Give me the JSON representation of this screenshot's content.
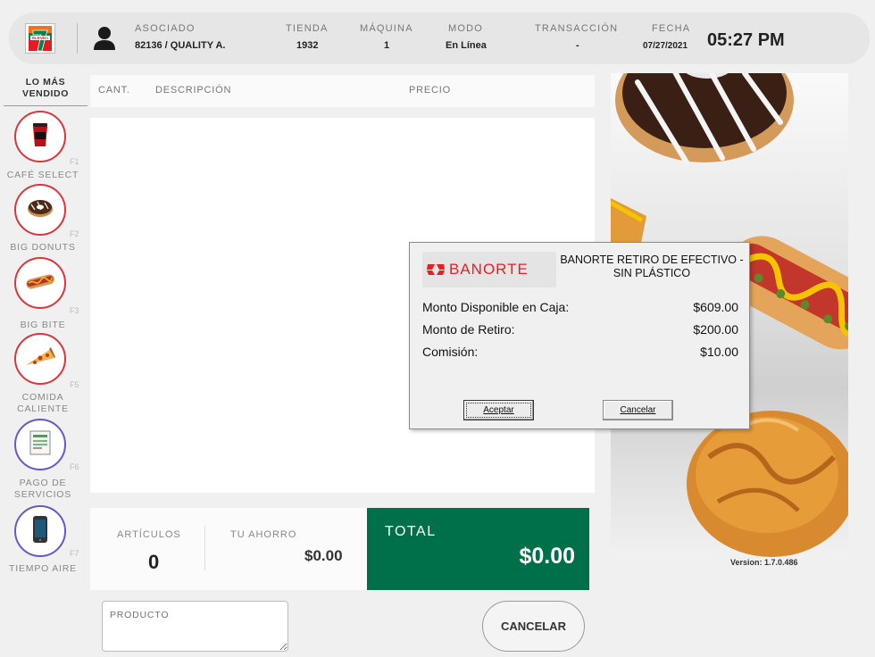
{
  "header": {
    "logo_text": "7-ELEVEn",
    "fields": [
      {
        "label": "ASOCIADO",
        "value": "82136  / QUALITY A."
      },
      {
        "label": "TIENDA",
        "value": "1932"
      },
      {
        "label": "MÁQUINA",
        "value": "1"
      },
      {
        "label": "MODO",
        "value": "En Línea"
      },
      {
        "label": "TRANSACCIÓN",
        "value": "-"
      },
      {
        "label": "FECHA",
        "value": "07/27/2021"
      }
    ],
    "time": "05:27 PM"
  },
  "sidebar": {
    "title": "LO MÁS VENDIDO",
    "categories": [
      {
        "key": "F1",
        "label": "CAFÉ SELECT",
        "icon": "coffee-cup-icon",
        "ring": "#d9363e"
      },
      {
        "key": "F2",
        "label": "BIG DONUTS",
        "icon": "donut-icon",
        "ring": "#d9363e"
      },
      {
        "key": "F3",
        "label": "BIG BITE",
        "icon": "hotdog-icon",
        "ring": "#d9363e"
      },
      {
        "key": "F5",
        "label": "COMIDA CALIENTE",
        "icon": "pizza-icon",
        "ring": "#d9363e"
      },
      {
        "key": "F6",
        "label": "PAGO DE SERVICIOS",
        "icon": "bill-icon",
        "ring": "#6a56c9"
      },
      {
        "key": "F7",
        "label": "TIEMPO AIRE",
        "icon": "phone-icon",
        "ring": "#6a56c9"
      }
    ]
  },
  "items": {
    "columns": [
      "CANT.",
      "DESCRIPCIÓN",
      "PRECIO"
    ],
    "rows": []
  },
  "totals": {
    "articulos_label": "ARTÍCULOS",
    "articulos_value": "0",
    "ahorro_label": "TU AHORRO",
    "ahorro_value": "$0.00",
    "total_label": "TOTAL",
    "total_value": "$0.00"
  },
  "bottom": {
    "producto_placeholder": "PRODUCTO",
    "cancel_label": "CANCELAR"
  },
  "promo": {
    "version": "Version: 1.7.0.486"
  },
  "dialog": {
    "logo_text": "BANORTE",
    "title": "BANORTE RETIRO DE EFECTIVO - SIN PLÁSTICO",
    "rows": [
      {
        "label": "Monto Disponible en Caja:",
        "value": "$609.00"
      },
      {
        "label": "Monto de Retiro:",
        "value": "$200.00"
      },
      {
        "label": "Comisión:",
        "value": "$10.00"
      }
    ],
    "accept_label": "Aceptar",
    "cancel_label": "Cancelar"
  },
  "colors": {
    "brand_green": "#00704a",
    "banorte_red": "#e41f26",
    "category_ring_red": "#d9363e",
    "category_ring_purple": "#6a56c9"
  }
}
